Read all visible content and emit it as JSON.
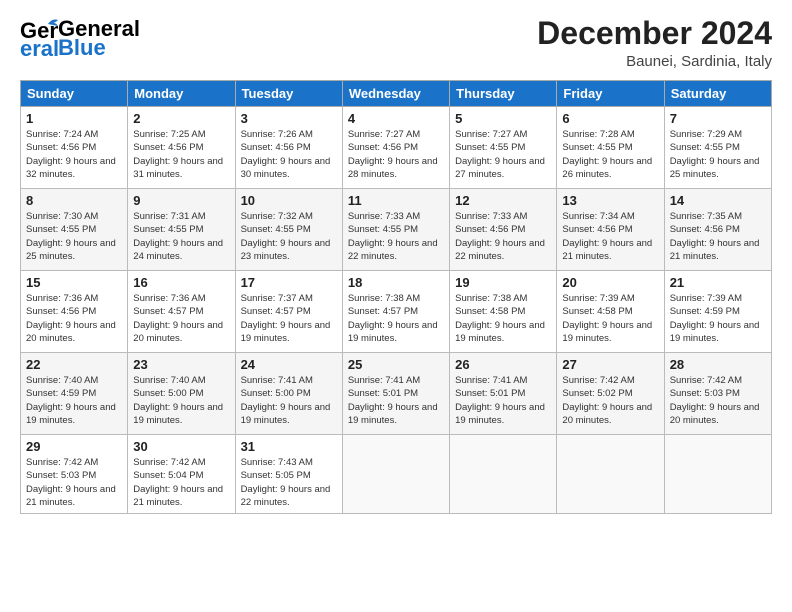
{
  "logo": {
    "general": "General",
    "blue": "Blue"
  },
  "header": {
    "month": "December 2024",
    "location": "Baunei, Sardinia, Italy"
  },
  "weekdays": [
    "Sunday",
    "Monday",
    "Tuesday",
    "Wednesday",
    "Thursday",
    "Friday",
    "Saturday"
  ],
  "weeks": [
    [
      {
        "day": "1",
        "sunrise": "7:24 AM",
        "sunset": "4:56 PM",
        "daylight": "9 hours and 32 minutes."
      },
      {
        "day": "2",
        "sunrise": "7:25 AM",
        "sunset": "4:56 PM",
        "daylight": "9 hours and 31 minutes."
      },
      {
        "day": "3",
        "sunrise": "7:26 AM",
        "sunset": "4:56 PM",
        "daylight": "9 hours and 30 minutes."
      },
      {
        "day": "4",
        "sunrise": "7:27 AM",
        "sunset": "4:56 PM",
        "daylight": "9 hours and 28 minutes."
      },
      {
        "day": "5",
        "sunrise": "7:27 AM",
        "sunset": "4:55 PM",
        "daylight": "9 hours and 27 minutes."
      },
      {
        "day": "6",
        "sunrise": "7:28 AM",
        "sunset": "4:55 PM",
        "daylight": "9 hours and 26 minutes."
      },
      {
        "day": "7",
        "sunrise": "7:29 AM",
        "sunset": "4:55 PM",
        "daylight": "9 hours and 25 minutes."
      }
    ],
    [
      {
        "day": "8",
        "sunrise": "7:30 AM",
        "sunset": "4:55 PM",
        "daylight": "9 hours and 25 minutes."
      },
      {
        "day": "9",
        "sunrise": "7:31 AM",
        "sunset": "4:55 PM",
        "daylight": "9 hours and 24 minutes."
      },
      {
        "day": "10",
        "sunrise": "7:32 AM",
        "sunset": "4:55 PM",
        "daylight": "9 hours and 23 minutes."
      },
      {
        "day": "11",
        "sunrise": "7:33 AM",
        "sunset": "4:55 PM",
        "daylight": "9 hours and 22 minutes."
      },
      {
        "day": "12",
        "sunrise": "7:33 AM",
        "sunset": "4:56 PM",
        "daylight": "9 hours and 22 minutes."
      },
      {
        "day": "13",
        "sunrise": "7:34 AM",
        "sunset": "4:56 PM",
        "daylight": "9 hours and 21 minutes."
      },
      {
        "day": "14",
        "sunrise": "7:35 AM",
        "sunset": "4:56 PM",
        "daylight": "9 hours and 21 minutes."
      }
    ],
    [
      {
        "day": "15",
        "sunrise": "7:36 AM",
        "sunset": "4:56 PM",
        "daylight": "9 hours and 20 minutes."
      },
      {
        "day": "16",
        "sunrise": "7:36 AM",
        "sunset": "4:57 PM",
        "daylight": "9 hours and 20 minutes."
      },
      {
        "day": "17",
        "sunrise": "7:37 AM",
        "sunset": "4:57 PM",
        "daylight": "9 hours and 19 minutes."
      },
      {
        "day": "18",
        "sunrise": "7:38 AM",
        "sunset": "4:57 PM",
        "daylight": "9 hours and 19 minutes."
      },
      {
        "day": "19",
        "sunrise": "7:38 AM",
        "sunset": "4:58 PM",
        "daylight": "9 hours and 19 minutes."
      },
      {
        "day": "20",
        "sunrise": "7:39 AM",
        "sunset": "4:58 PM",
        "daylight": "9 hours and 19 minutes."
      },
      {
        "day": "21",
        "sunrise": "7:39 AM",
        "sunset": "4:59 PM",
        "daylight": "9 hours and 19 minutes."
      }
    ],
    [
      {
        "day": "22",
        "sunrise": "7:40 AM",
        "sunset": "4:59 PM",
        "daylight": "9 hours and 19 minutes."
      },
      {
        "day": "23",
        "sunrise": "7:40 AM",
        "sunset": "5:00 PM",
        "daylight": "9 hours and 19 minutes."
      },
      {
        "day": "24",
        "sunrise": "7:41 AM",
        "sunset": "5:00 PM",
        "daylight": "9 hours and 19 minutes."
      },
      {
        "day": "25",
        "sunrise": "7:41 AM",
        "sunset": "5:01 PM",
        "daylight": "9 hours and 19 minutes."
      },
      {
        "day": "26",
        "sunrise": "7:41 AM",
        "sunset": "5:01 PM",
        "daylight": "9 hours and 19 minutes."
      },
      {
        "day": "27",
        "sunrise": "7:42 AM",
        "sunset": "5:02 PM",
        "daylight": "9 hours and 20 minutes."
      },
      {
        "day": "28",
        "sunrise": "7:42 AM",
        "sunset": "5:03 PM",
        "daylight": "9 hours and 20 minutes."
      }
    ],
    [
      {
        "day": "29",
        "sunrise": "7:42 AM",
        "sunset": "5:03 PM",
        "daylight": "9 hours and 21 minutes."
      },
      {
        "day": "30",
        "sunrise": "7:42 AM",
        "sunset": "5:04 PM",
        "daylight": "9 hours and 21 minutes."
      },
      {
        "day": "31",
        "sunrise": "7:43 AM",
        "sunset": "5:05 PM",
        "daylight": "9 hours and 22 minutes."
      },
      null,
      null,
      null,
      null
    ]
  ],
  "labels": {
    "sunrise": "Sunrise:",
    "sunset": "Sunset:",
    "daylight": "Daylight:"
  }
}
